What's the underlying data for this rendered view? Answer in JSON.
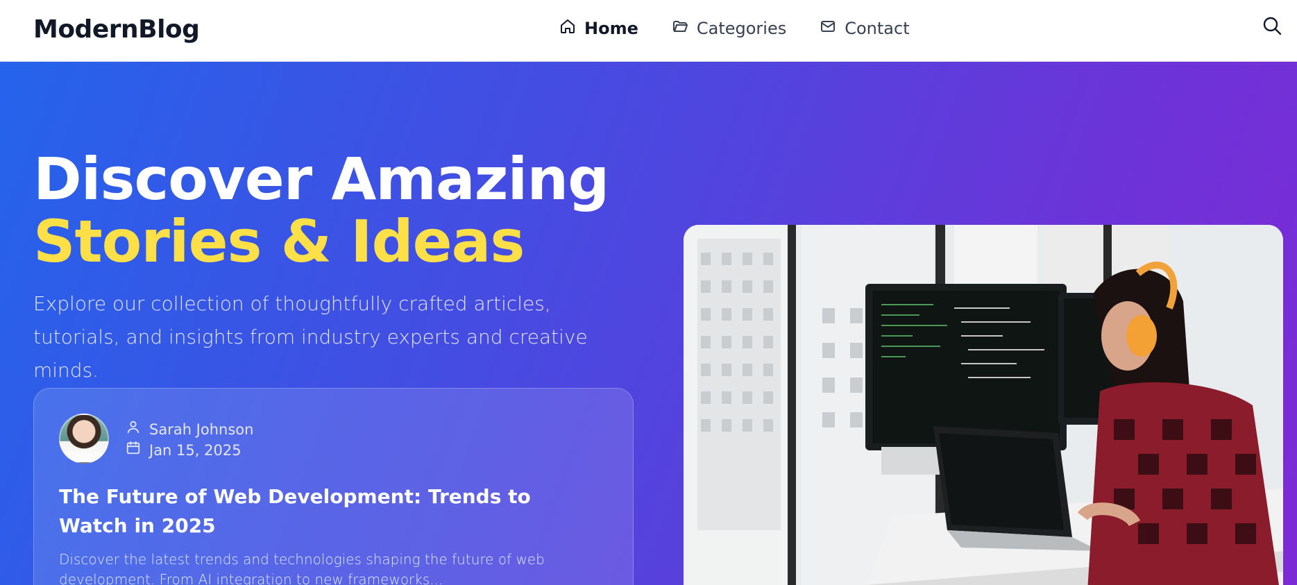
{
  "app": {
    "logo": "ModernBlog"
  },
  "nav": {
    "items": [
      {
        "label": "Home",
        "icon": "home-icon",
        "active": true
      },
      {
        "label": "Categories",
        "icon": "folder-icon",
        "active": false
      },
      {
        "label": "Contact",
        "icon": "mail-icon",
        "active": false
      }
    ],
    "search_icon": "search-icon"
  },
  "hero": {
    "title_line1": "Discover Amazing",
    "title_line2": "Stories & Ideas",
    "subtitle": "Explore our collection of thoughtfully crafted articles, tutorials, and insights from industry experts and creative minds.",
    "accent_color": "#fde047",
    "gradient_start": "#2563eb",
    "gradient_end": "#7c2ad6"
  },
  "featured": {
    "author": "Sarah Johnson",
    "date": "Jan 15, 2025",
    "title": "The Future of Web Development: Trends to Watch in 2025",
    "excerpt": "Discover the latest trends and technologies shaping the future of web development. From AI integration to new frameworks..."
  }
}
